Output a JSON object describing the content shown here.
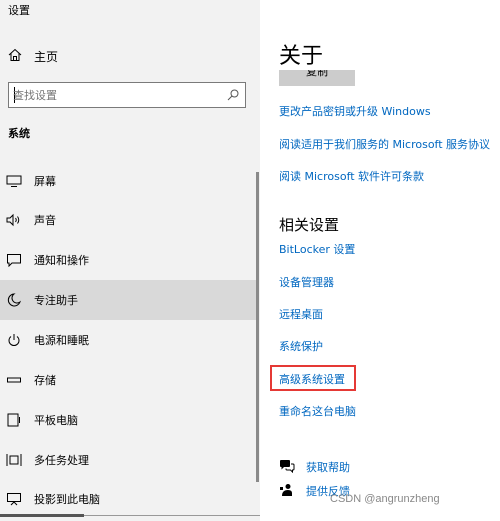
{
  "window": {
    "title": "设置"
  },
  "sidebar": {
    "home_label": "主页",
    "search": {
      "placeholder": "查找设置",
      "value": ""
    },
    "section_label": "系统",
    "items": [
      {
        "label": "屏幕",
        "icon": "display-icon",
        "active": false
      },
      {
        "label": "声音",
        "icon": "speaker-icon",
        "active": false
      },
      {
        "label": "通知和操作",
        "icon": "notification-icon",
        "active": false
      },
      {
        "label": "专注助手",
        "icon": "moon-icon",
        "active": true
      },
      {
        "label": "电源和睡眠",
        "icon": "power-icon",
        "active": false
      },
      {
        "label": "存储",
        "icon": "storage-icon",
        "active": false
      },
      {
        "label": "平板电脑",
        "icon": "tablet-icon",
        "active": false
      },
      {
        "label": "多任务处理",
        "icon": "multitask-icon",
        "active": false
      },
      {
        "label": "投影到此电脑",
        "icon": "project-icon",
        "active": false
      }
    ]
  },
  "content": {
    "title": "关于",
    "copy_button": "复制",
    "links": [
      "更改产品密钥或升级 Windows",
      "阅读适用于我们服务的 Microsoft 服务协议",
      "阅读 Microsoft 软件许可条款"
    ],
    "related_title": "相关设置",
    "related_links": [
      "BitLocker 设置",
      "设备管理器",
      "远程桌面",
      "系统保护",
      "高级系统设置",
      "重命名这台电脑"
    ],
    "help": {
      "get_help": "获取帮助",
      "feedback": "提供反馈"
    }
  },
  "watermark": "CSDN @angrunzheng",
  "colors": {
    "accent": "#0067c0",
    "sidebar_bg": "#f2f2f2",
    "active_bg": "#d9d9d9",
    "highlight": "#e53935"
  }
}
